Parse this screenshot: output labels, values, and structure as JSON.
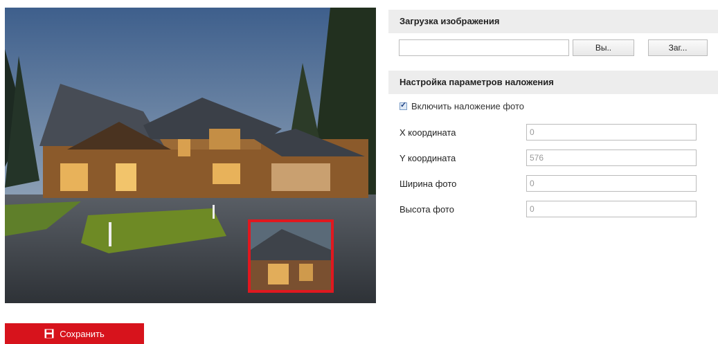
{
  "upload": {
    "title": "Загрузка изображения",
    "file_value": "",
    "browse_label": "Вы..",
    "upload_label": "Заг..."
  },
  "overlay": {
    "title": "Настройка параметров наложения",
    "enable_label": "Включить наложение фото",
    "enable_checked": true,
    "fields": [
      {
        "label": "X координата",
        "value": "0"
      },
      {
        "label": "Y координата",
        "value": "576"
      },
      {
        "label": "Ширина фото",
        "value": "0"
      },
      {
        "label": "Высота фото",
        "value": "0"
      }
    ]
  },
  "save": {
    "label": "Сохранить",
    "icon": "floppy-disk-icon"
  },
  "colors": {
    "accent": "#d7131c",
    "overlay_border": "#e0181f"
  }
}
